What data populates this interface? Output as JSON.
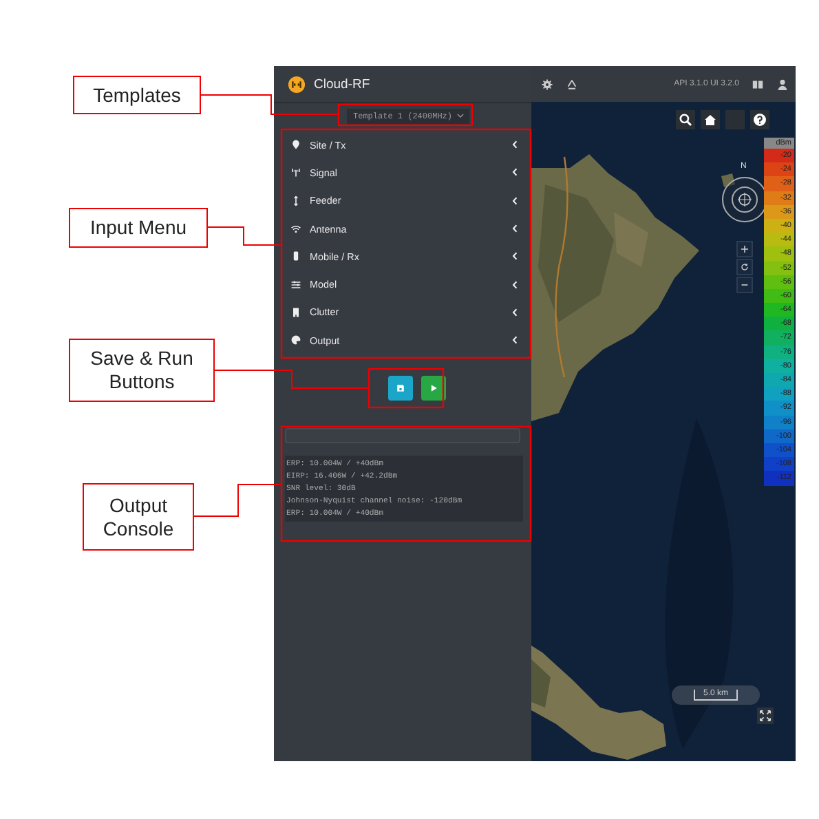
{
  "annotations": [
    {
      "label": "Templates"
    },
    {
      "label": "Input Menu"
    },
    {
      "label": "Save & Run Buttons"
    },
    {
      "label": "Output Console"
    }
  ],
  "app": {
    "title": "Cloud-RF",
    "version": "API 3.1.0 UI 3.2.0",
    "template": "Template 1 (2400MHz)",
    "menu": [
      {
        "label": "Site / Tx",
        "kind": "pin"
      },
      {
        "label": "Signal",
        "kind": "antenna"
      },
      {
        "label": "Feeder",
        "kind": "updown"
      },
      {
        "label": "Antenna",
        "kind": "wifi"
      },
      {
        "label": "Mobile / Rx",
        "kind": "mobile"
      },
      {
        "label": "Model",
        "kind": "sliders"
      },
      {
        "label": "Clutter",
        "kind": "building"
      },
      {
        "label": "Output",
        "kind": "palette"
      }
    ],
    "console": [
      "ERP: 10.004W / +40dBm",
      "EIRP: 16.406W / +42.2dBm",
      "SNR level: 30dB",
      "Johnson-Nyquist channel noise: -120dBm",
      "ERP: 10.004W / +40dBm"
    ]
  },
  "map": {
    "legend_unit": "dBm",
    "legend": [
      {
        "label": "-20",
        "color": "#d42a1a"
      },
      {
        "label": "-24",
        "color": "#dc4416"
      },
      {
        "label": "-28",
        "color": "#e06018"
      },
      {
        "label": "-32",
        "color": "#e07c18"
      },
      {
        "label": "-36",
        "color": "#dc9818"
      },
      {
        "label": "-40",
        "color": "#ccb014"
      },
      {
        "label": "-44",
        "color": "#b8bc10"
      },
      {
        "label": "-48",
        "color": "#a0c010"
      },
      {
        "label": "-52",
        "color": "#84c010"
      },
      {
        "label": "-56",
        "color": "#60be10"
      },
      {
        "label": "-60",
        "color": "#40bc14"
      },
      {
        "label": "-64",
        "color": "#20b820"
      },
      {
        "label": "-68",
        "color": "#10b040"
      },
      {
        "label": "-72",
        "color": "#10b060"
      },
      {
        "label": "-76",
        "color": "#10b080"
      },
      {
        "label": "-80",
        "color": "#10b0a0"
      },
      {
        "label": "-84",
        "color": "#10a8b0"
      },
      {
        "label": "-88",
        "color": "#10a0c0"
      },
      {
        "label": "-92",
        "color": "#1090c8"
      },
      {
        "label": "-96",
        "color": "#1080c8"
      },
      {
        "label": "-100",
        "color": "#1068c8"
      },
      {
        "label": "-104",
        "color": "#1050c8"
      },
      {
        "label": "-108",
        "color": "#1040c8"
      },
      {
        "label": "-112",
        "color": "#1030c0"
      }
    ],
    "scale": "5.0 km",
    "compass_north": "N"
  }
}
